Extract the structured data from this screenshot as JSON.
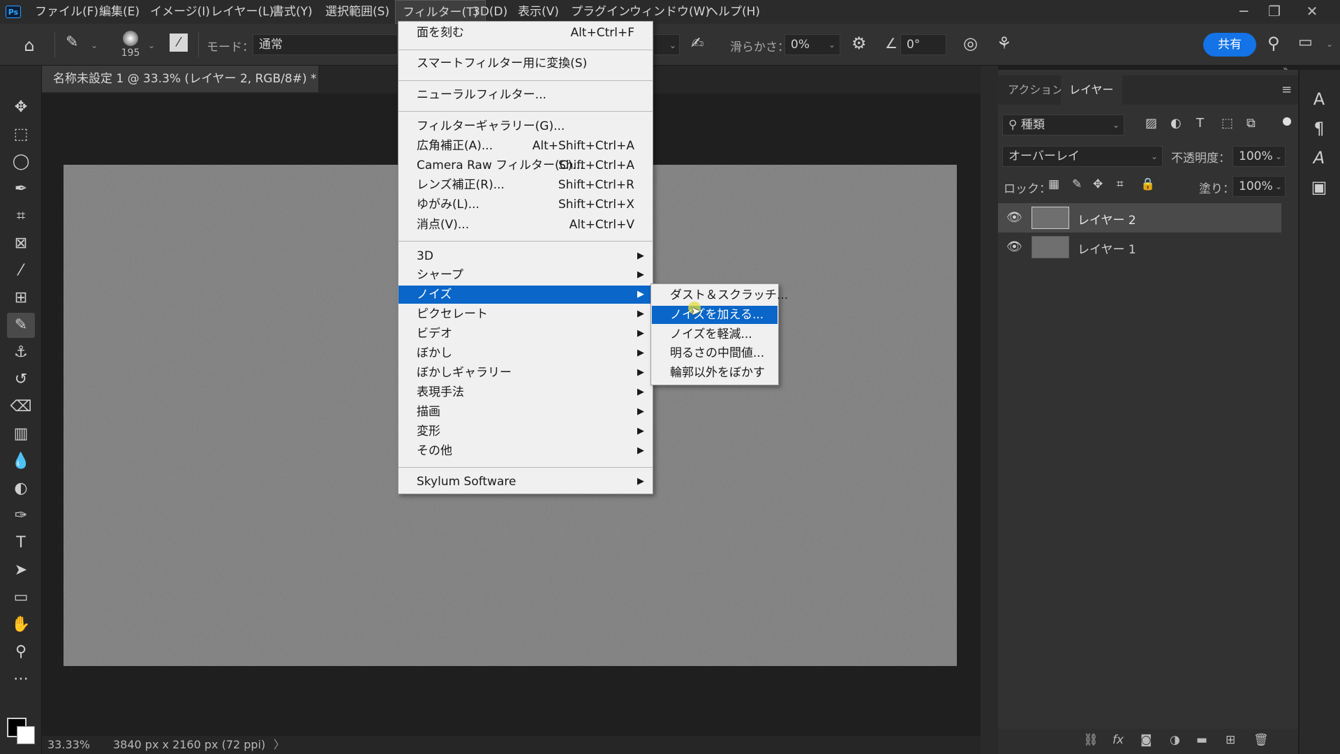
{
  "menubar": {
    "logo": "Ps",
    "items": [
      "ファイル(F)",
      "編集(E)",
      "イメージ(I)",
      "レイヤー(L)",
      "書式(Y)",
      "選択範囲(S)",
      "フィルター(T)",
      "3D(D)",
      "表示(V)",
      "プラグイン",
      "ウィンドウ(W)",
      "ヘルプ(H)"
    ],
    "active_item": "フィルター(T)"
  },
  "options": {
    "brush_size": "195",
    "mode_label": "モード：",
    "mode_value": "通常",
    "smoothing_label": "滑らかさ：",
    "smoothing_value": "0%",
    "angle_value": "0°",
    "share_label": "共有"
  },
  "document": {
    "tab_title": "名称未設定 1 @ 33.3% (レイヤー 2, RGB/8#) *",
    "close": "×",
    "canvas_color": "#777777"
  },
  "status": {
    "zoom": "33.33%",
    "dimensions": "3840 px x 2160 px (72 ppi)",
    "arrow": "〉"
  },
  "filter_menu": {
    "items": [
      {
        "label": "面を刻む",
        "shortcut": "Alt+Ctrl+F"
      },
      {
        "label": "スマートフィルター用に変換(S)",
        "shortcut": ""
      },
      {
        "label": "ニューラルフィルター...",
        "shortcut": ""
      },
      {
        "label": "フィルターギャラリー(G)...",
        "shortcut": ""
      },
      {
        "label": "広角補正(A)...",
        "shortcut": "Alt+Shift+Ctrl+A"
      },
      {
        "label": "Camera Raw フィルター(C)...",
        "shortcut": "Shift+Ctrl+A"
      },
      {
        "label": "レンズ補正(R)...",
        "shortcut": "Shift+Ctrl+R"
      },
      {
        "label": "ゆがみ(L)...",
        "shortcut": "Shift+Ctrl+X"
      },
      {
        "label": "消点(V)...",
        "shortcut": "Alt+Ctrl+V"
      },
      {
        "label": "3D"
      },
      {
        "label": "シャープ"
      },
      {
        "label": "ノイズ"
      },
      {
        "label": "ピクセレート"
      },
      {
        "label": "ビデオ"
      },
      {
        "label": "ぼかし"
      },
      {
        "label": "ぼかしギャラリー"
      },
      {
        "label": "表現手法"
      },
      {
        "label": "描画"
      },
      {
        "label": "変形"
      },
      {
        "label": "その他"
      },
      {
        "label": "Skylum Software"
      }
    ],
    "highlighted": "ノイズ"
  },
  "noise_submenu": {
    "items": [
      "ダスト＆スクラッチ...",
      "ノイズを加える...",
      "ノイズを軽減...",
      "明るさの中間値...",
      "輪郭以外をぼかす"
    ],
    "highlighted": "ノイズを加える..."
  },
  "layers_panel": {
    "tabs": [
      "アクション",
      "レイヤー"
    ],
    "active_tab": "レイヤー",
    "search_label": "種類",
    "blend_mode": "オーバーレイ",
    "opacity_label": "不透明度：",
    "opacity_value": "100%",
    "lock_label": "ロック：",
    "fill_label": "塗り：",
    "fill_value": "100%",
    "layers": [
      {
        "name": "レイヤー 2",
        "visible": true,
        "selected": true
      },
      {
        "name": "レイヤー 1",
        "visible": true,
        "selected": false
      }
    ]
  },
  "colors": {
    "accent": "#1473e6",
    "menu_highlight": "#0a66c8",
    "menu_bg": "#f0f0f0",
    "app_bg": "#1e1e1e"
  }
}
